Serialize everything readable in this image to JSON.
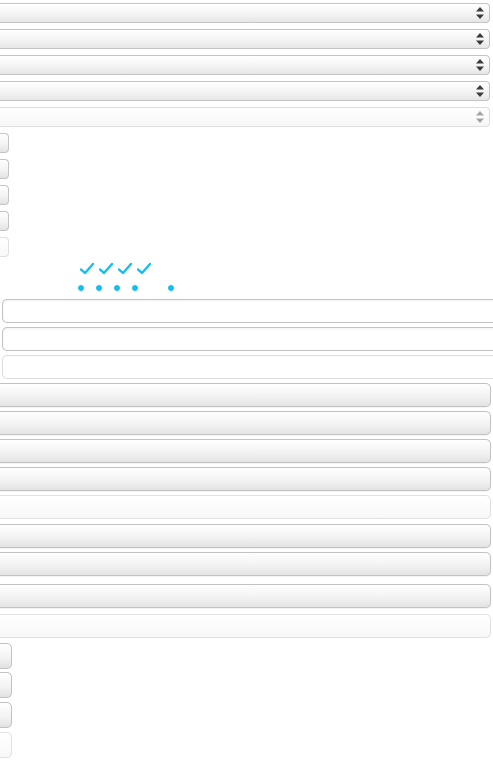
{
  "colors": {
    "accent": "#13bfee",
    "border": "#c4c4c4",
    "border_disabled": "#dedede",
    "background": "#ffffff"
  },
  "selects": [
    {
      "name": "select-1",
      "value": "",
      "disabled": false,
      "icon": "up-down-arrows-icon"
    },
    {
      "name": "select-2",
      "value": "",
      "disabled": false,
      "icon": "up-down-arrows-icon"
    },
    {
      "name": "select-3",
      "value": "",
      "disabled": false,
      "icon": "up-down-arrows-icon"
    },
    {
      "name": "select-4",
      "value": "",
      "disabled": false,
      "icon": "up-down-arrows-icon"
    },
    {
      "name": "select-5",
      "value": "",
      "disabled": true,
      "icon": "up-down-arrows-icon"
    }
  ],
  "checkboxes": [
    {
      "name": "checkbox-1",
      "disabled": false
    },
    {
      "name": "checkbox-2",
      "disabled": false
    },
    {
      "name": "checkbox-3",
      "disabled": false
    },
    {
      "name": "checkbox-4",
      "disabled": false
    },
    {
      "name": "checkbox-5",
      "disabled": true
    }
  ],
  "indicators": {
    "checks": [
      "check-icon",
      "check-icon",
      "check-icon",
      "check-icon"
    ],
    "dots": [
      "dot-icon",
      "dot-icon",
      "dot-icon",
      "dot-icon",
      "dot-icon"
    ]
  },
  "inputs": [
    {
      "name": "text-input-1",
      "value": "",
      "placeholder": "",
      "disabled": false
    },
    {
      "name": "text-input-2",
      "value": "",
      "placeholder": "",
      "disabled": false
    },
    {
      "name": "text-input-3",
      "value": "",
      "placeholder": "",
      "disabled": true
    }
  ],
  "buttons": [
    {
      "name": "button-1",
      "label": "",
      "disabled": false
    },
    {
      "name": "button-2",
      "label": "",
      "disabled": false
    },
    {
      "name": "button-3",
      "label": "",
      "disabled": false
    },
    {
      "name": "button-4",
      "label": "",
      "disabled": false
    },
    {
      "name": "button-5",
      "label": "",
      "disabled": true
    },
    {
      "name": "button-6",
      "label": "",
      "disabled": false
    },
    {
      "name": "button-7",
      "label": "",
      "disabled": false
    },
    {
      "name": "button-8",
      "label": "",
      "disabled": false
    },
    {
      "name": "button-9",
      "label": "",
      "disabled": true
    }
  ],
  "small_buttons": [
    {
      "name": "small-button-1",
      "disabled": false
    },
    {
      "name": "small-button-2",
      "disabled": false
    },
    {
      "name": "small-button-3",
      "disabled": false
    },
    {
      "name": "small-button-4",
      "disabled": true
    }
  ]
}
